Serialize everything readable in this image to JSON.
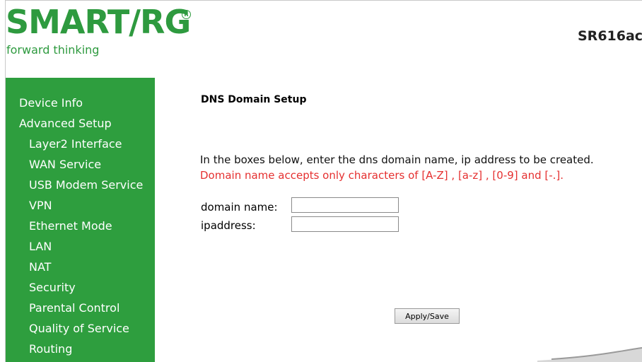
{
  "brand": {
    "logo_text": "SMART/RG",
    "registered_mark": "R",
    "tagline": "forward thinking",
    "model": "SR616ac"
  },
  "sidebar": {
    "items": [
      {
        "label": "Device Info",
        "level": 0
      },
      {
        "label": "Advanced Setup",
        "level": 0
      },
      {
        "label": "Layer2 Interface",
        "level": 1
      },
      {
        "label": "WAN Service",
        "level": 1
      },
      {
        "label": "USB Modem Service",
        "level": 1
      },
      {
        "label": "VPN",
        "level": 1
      },
      {
        "label": "Ethernet Mode",
        "level": 1
      },
      {
        "label": "LAN",
        "level": 1
      },
      {
        "label": "NAT",
        "level": 1
      },
      {
        "label": "Security",
        "level": 1
      },
      {
        "label": "Parental Control",
        "level": 1
      },
      {
        "label": "Quality of Service",
        "level": 1
      },
      {
        "label": "Routing",
        "level": 1
      }
    ]
  },
  "main": {
    "title": "DNS Domain Setup",
    "info_text": "In the boxes below, enter the dns domain name, ip address to be created.",
    "warning_text": "Domain name accepts only characters of [A-Z] , [a-z] , [0-9] and [-.].",
    "fields": {
      "domain_label": "domain name:",
      "domain_value": "",
      "ip_label": "ipaddress:",
      "ip_value": ""
    },
    "apply_label": "Apply/Save"
  },
  "colors": {
    "brand_green": "#2e9a3f",
    "sidebar_green": "#2e9e3e",
    "warning_red": "#e53030"
  }
}
